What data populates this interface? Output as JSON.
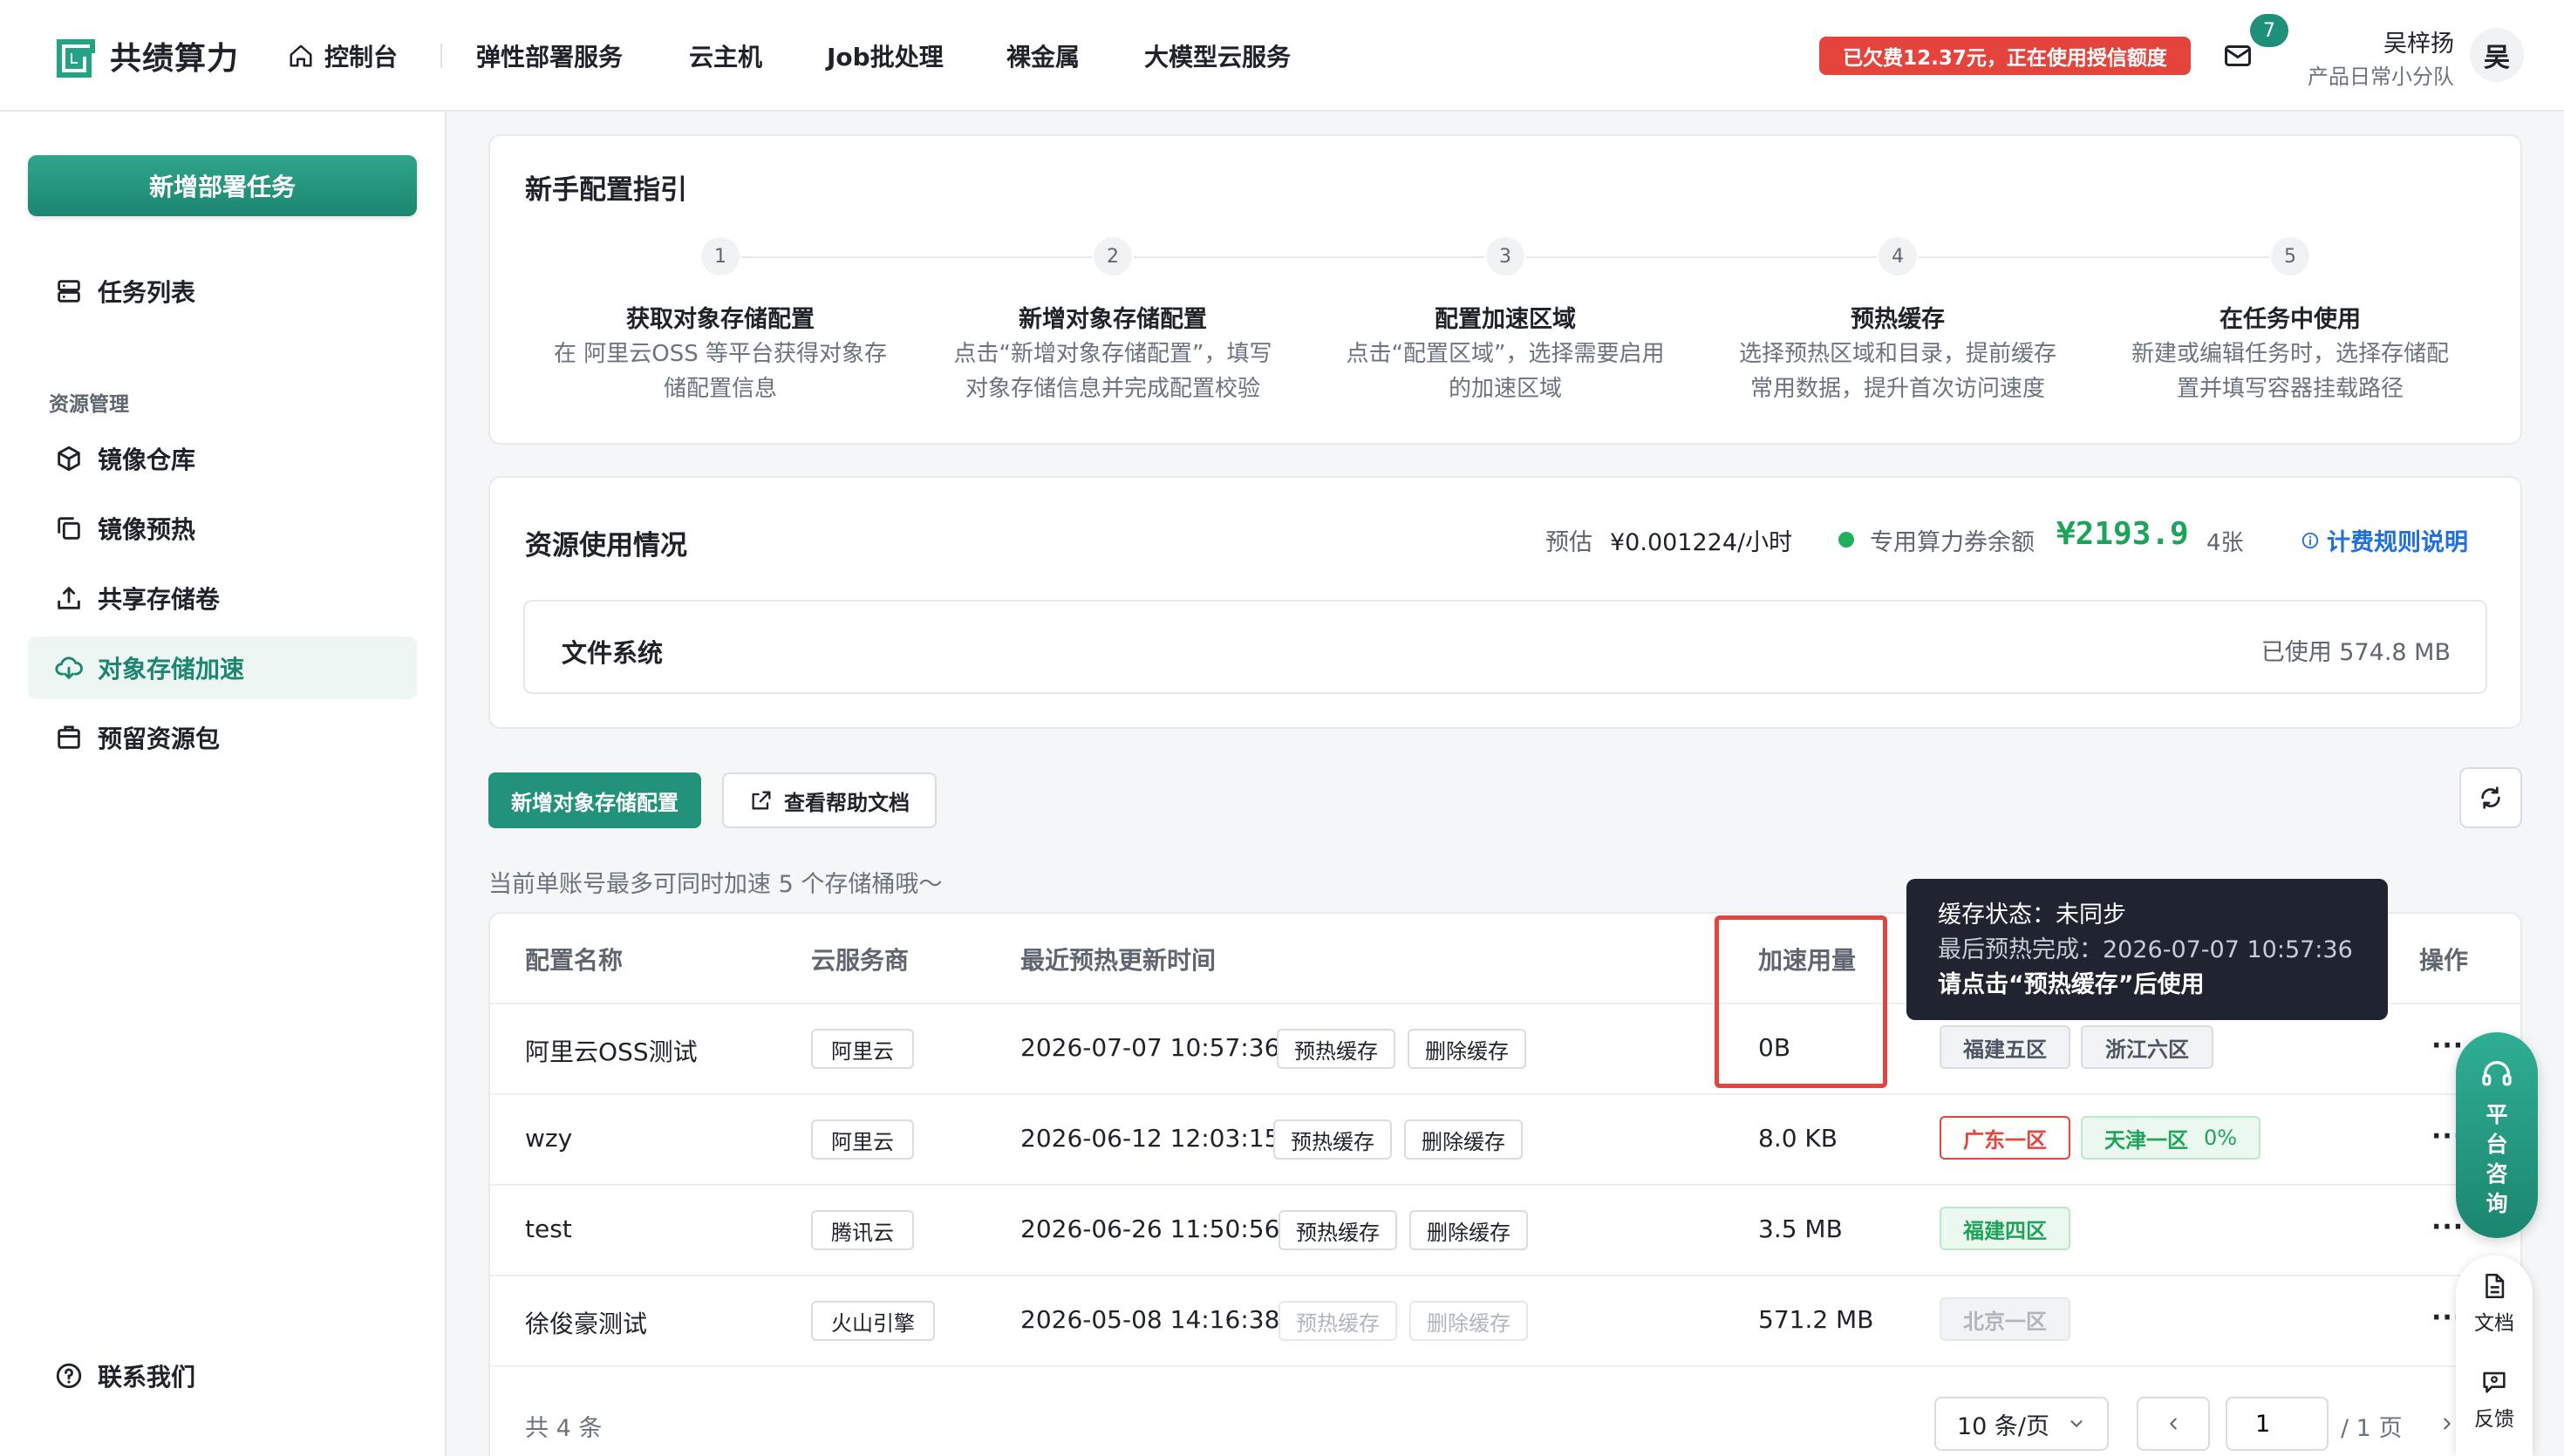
{
  "header": {
    "logo_text": "共绩算力",
    "nav_home": "控制台",
    "nav": [
      "弹性部署服务",
      "云主机",
      "Job批处理",
      "裸金属",
      "大模型云服务"
    ],
    "arrears_notice": "已欠费12.37元，正在使用授信额度",
    "mail_count": "7",
    "user_name": "吴梓扬",
    "user_team": "产品日常小分队",
    "avatar_text": "吴"
  },
  "sidebar": {
    "new_task_button": "新增部署任务",
    "task_list": "任务列表",
    "group_title": "资源管理",
    "items": [
      "镜像仓库",
      "镜像预热",
      "共享存储卷",
      "对象存储加速",
      "预留资源包"
    ],
    "contact": "联系我们"
  },
  "guide": {
    "title": "新手配置指引",
    "steps": [
      {
        "num": "1",
        "title": "获取对象存储配置",
        "desc1": "在 阿里云OSS 等平台获得对象存",
        "desc2": "储配置信息"
      },
      {
        "num": "2",
        "title": "新增对象存储配置",
        "desc1": "点击“新增对象存储配置”，填写",
        "desc2": "对象存储信息并完成配置校验"
      },
      {
        "num": "3",
        "title": "配置加速区域",
        "desc1": "点击“配置区域”，选择需要启用",
        "desc2": "的加速区域"
      },
      {
        "num": "4",
        "title": "预热缓存",
        "desc1": "选择预热区域和目录，提前缓存",
        "desc2": "常用数据，提升首次访问速度"
      },
      {
        "num": "5",
        "title": "在任务中使用",
        "desc1": "新建或编辑任务时，选择存储配",
        "desc2": "置并填写容器挂载路径"
      }
    ]
  },
  "usage": {
    "title": "资源使用情况",
    "estimate_label": "预估",
    "estimate_value": "¥0.001224/小时",
    "voucher_label": "专用算力券余额",
    "voucher_value": "¥2193.9",
    "voucher_count": "4张",
    "billing_link": "计费规则说明",
    "fs_label": "文件系统",
    "fs_used": "已使用 574.8 MB"
  },
  "toolbar": {
    "add_button": "新增对象存储配置",
    "help_button": "查看帮助文档",
    "hint": "当前单账号最多可同时加速 5 个存储桶哦～"
  },
  "table": {
    "headers": {
      "name": "配置名称",
      "provider": "云服务商",
      "time": "最近预热更新时间",
      "usage": "加速用量",
      "actions": "操作"
    },
    "warm_label": "预热缓存",
    "delete_label": "删除缓存",
    "more": "···",
    "rows": [
      {
        "name": "阿里云OSS测试",
        "provider": "阿里云",
        "time": "2026-07-07 10:57:36",
        "usage": "0B",
        "zones": [
          "福建五区",
          "浙江六区"
        ]
      },
      {
        "name": "wzy",
        "provider": "阿里云",
        "time": "2026-06-12 12:03:15",
        "usage": "8.0 KB",
        "zones": [
          "广东一区",
          "天津一区"
        ],
        "zone2_percent": "0%"
      },
      {
        "name": "test",
        "provider": "腾讯云",
        "time": "2026-06-26 11:50:56",
        "usage": "3.5 MB",
        "zones": [
          "福建四区"
        ]
      },
      {
        "name": "徐俊豪测试",
        "provider": "火山引擎",
        "time": "2026-05-08 14:16:38",
        "usage": "571.2 MB",
        "zones": [
          "北京一区"
        ]
      }
    ],
    "total": "共 4 条",
    "page_size": "10 条/页",
    "page_current": "1",
    "page_total": "/ 1 页"
  },
  "tooltip": {
    "line1": "缓存状态：未同步",
    "line2": "最后预热完成：2026-07-07 10:57:36",
    "line3": "请点击“预热缓存”后使用"
  },
  "floating": {
    "consult": "平台咨询",
    "docs": "文档",
    "feedback": "反馈"
  },
  "colors": {
    "brand": "#1c8670",
    "danger": "#e5443d",
    "success": "#1ea35a",
    "link": "#1f6fde"
  }
}
